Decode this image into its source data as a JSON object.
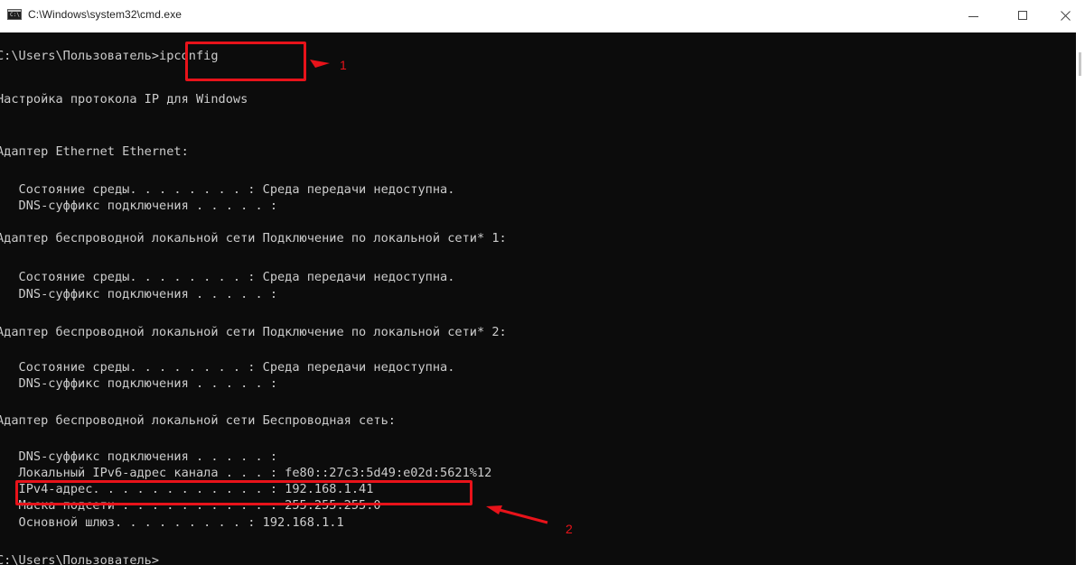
{
  "window": {
    "title": "C:\\Windows\\system32\\cmd.exe",
    "icon_label": "C:\\",
    "controls": [
      "minimize",
      "maximize",
      "close"
    ]
  },
  "console": {
    "lines": [
      "C:\\Users\\Пользователь>ipconfig",
      "",
      "Настройка протокола IP для Windows",
      "",
      "",
      "Адаптер Ethernet Ethernet:",
      "",
      "   Состояние среды. . . . . . . . : Среда передачи недоступна.",
      "   DNS-суффикс подключения . . . . . :",
      "",
      "Адаптер беспроводной локальной сети Подключение по локальной сети* 1:",
      "",
      "   Состояние среды. . . . . . . . : Среда передачи недоступна.",
      "   DNS-суффикс подключения . . . . . :",
      "",
      "Адаптер беспроводной локальной сети Подключение по локальной сети* 2:",
      "",
      "   Состояние среды. . . . . . . . : Среда передачи недоступна.",
      "   DNS-суффикс подключения . . . . . :",
      "",
      "Адаптер беспроводной локальной сети Беспроводная сеть:",
      "",
      "   DNS-суффикс подключения . . . . . :",
      "   Локальный IPv6-адрес канала . . . : fe80::27c3:5d49:e02d:5621%12",
      "   IPv4-адрес. . . . . . . . . . . . : 192.168.1.41",
      "   Маска подсети . . . . . . . . . . : 255.255.255.0",
      "   Основной шлюз. . . . . . . . . : 192.168.1.1",
      "",
      "C:\\Users\\Пользователь>"
    ]
  },
  "annotations": {
    "marker_1": "1",
    "marker_2": "2",
    "color": "#e8131a"
  },
  "colors": {
    "console_bg": "#0c0c0c",
    "console_text": "#cccccc",
    "titlebar_bg": "#ffffff"
  }
}
